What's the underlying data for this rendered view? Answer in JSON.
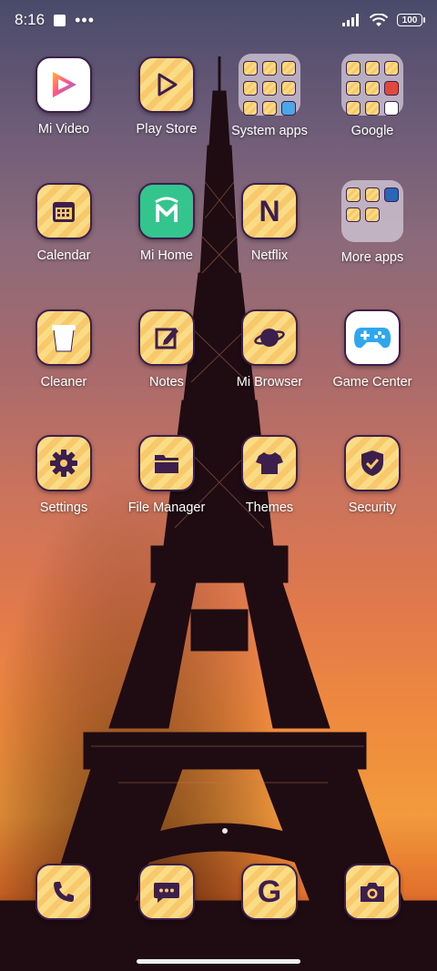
{
  "status": {
    "time": "8:16",
    "battery": "100"
  },
  "apps": {
    "mi_video": "Mi Video",
    "play_store": "Play Store",
    "system_apps": "System apps",
    "google": "Google",
    "calendar": "Calendar",
    "mi_home": "Mi Home",
    "netflix": "Netflix",
    "more_apps": "More apps",
    "cleaner": "Cleaner",
    "notes": "Notes",
    "mi_browser": "Mi Browser",
    "game_center": "Game Center",
    "settings": "Settings",
    "file_manager": "File Manager",
    "themes": "Themes",
    "security": "Security"
  },
  "icons": {
    "netflix_glyph": "N",
    "google_glyph": "G"
  },
  "colors": {
    "icon_border": "#3c1f4d",
    "icon_fg": "#3c1f4d",
    "icon_bg": "#f7c96a"
  }
}
